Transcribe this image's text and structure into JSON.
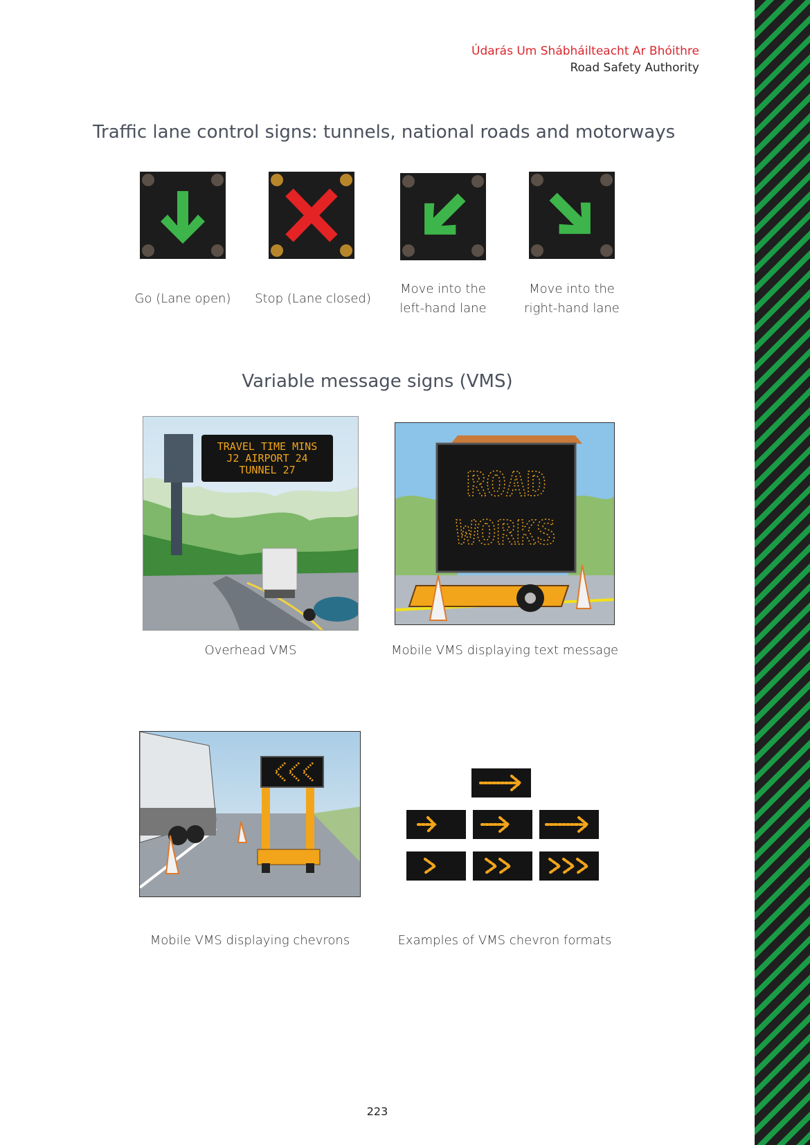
{
  "header": {
    "irish": "Údarás Um Shábháilteacht Ar Bhóithre",
    "english": "Road Safety Authority"
  },
  "section1": {
    "title": "Traffic lane control signs: tunnels, national roads and motorways",
    "signs": [
      {
        "icon": "arrow-down-icon",
        "color": "#3db54a",
        "caption_line1": "Go (Lane open)",
        "caption_line2": ""
      },
      {
        "icon": "red-cross-icon",
        "color": "#e42325",
        "caption_line1": "Stop (Lane closed)",
        "caption_line2": ""
      },
      {
        "icon": "arrow-down-left-icon",
        "color": "#3db54a",
        "caption_line1": "Move into the",
        "caption_line2": "left-hand lane"
      },
      {
        "icon": "arrow-down-right-icon",
        "color": "#3db54a",
        "caption_line1": "Move into the",
        "caption_line2": "right-hand lane"
      }
    ]
  },
  "section2": {
    "title": "Variable message signs (VMS)",
    "images": [
      {
        "icon": "overhead-vms-illustration",
        "caption": "Overhead VMS",
        "sign_text": [
          "TRAVEL TIME MINS",
          "J2 AIRPORT 24",
          "TUNNEL 27"
        ]
      },
      {
        "icon": "mobile-vms-text-illustration",
        "caption": "Mobile VMS displaying text message",
        "sign_text": [
          "ROAD",
          "WORKS"
        ]
      },
      {
        "icon": "mobile-vms-chevron-illustration",
        "caption": "Mobile VMS displaying chevrons"
      },
      {
        "icon": "chevron-formats-illustration",
        "caption": "Examples of VMS chevron formats"
      }
    ]
  },
  "colors": {
    "led_amber": "#f2a51a",
    "sign_green": "#3db54a",
    "sign_red": "#e42325",
    "brand_red": "#d8282f"
  },
  "page_number": "223"
}
